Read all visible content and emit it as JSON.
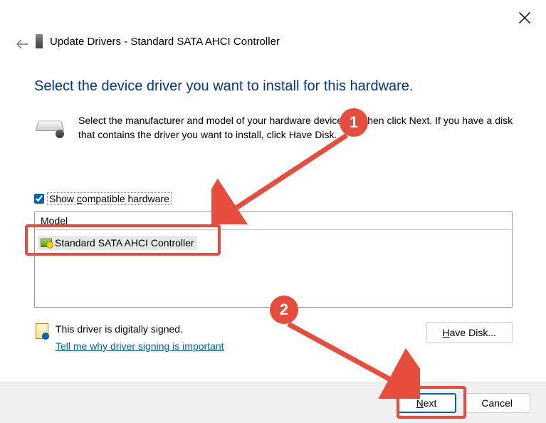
{
  "window": {
    "title": "Update Drivers - Standard SATA AHCI Controller"
  },
  "subtitle": "Select the device driver you want to install for this hardware.",
  "instruction": "Select the manufacturer and model of your hardware device and then click Next. If you have a disk that contains the driver you want to install, click Have Disk.",
  "checkbox": {
    "label_prefix": "Show ",
    "label_underlined": "c",
    "label_suffix": "ompatible hardware"
  },
  "model": {
    "header": "Model",
    "items": [
      {
        "text": "Standard SATA AHCI Controller"
      }
    ]
  },
  "signing": {
    "text": "This driver is digitally signed.",
    "link": "Tell me why driver signing is important"
  },
  "buttons": {
    "have_disk_u": "H",
    "have_disk_rest": "ave Disk...",
    "next_u": "N",
    "next_rest": "ext",
    "cancel": "Cancel"
  },
  "annotations": {
    "num1": "1",
    "num2": "2"
  }
}
